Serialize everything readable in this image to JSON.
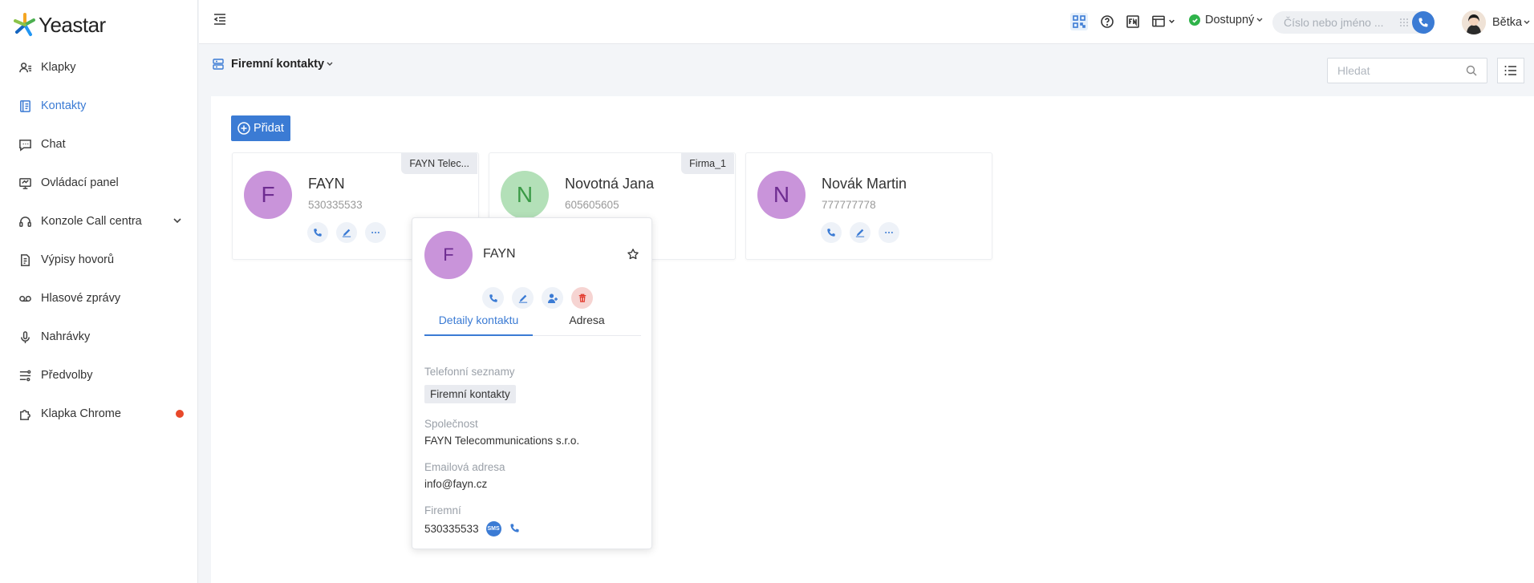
{
  "app": {
    "brand": "Yeastar"
  },
  "sidebar": {
    "items": [
      {
        "label": "Klapky",
        "icon": "user-list-icon"
      },
      {
        "label": "Kontakty",
        "icon": "contacts-book-icon",
        "active": true
      },
      {
        "label": "Chat",
        "icon": "chat-bubble-icon"
      },
      {
        "label": "Ovládací panel",
        "icon": "dashboard-icon"
      },
      {
        "label": "Konzole Call centra",
        "icon": "headset-icon",
        "expandable": true
      },
      {
        "label": "Výpisy hovorů",
        "icon": "call-log-icon"
      },
      {
        "label": "Hlasové zprávy",
        "icon": "voicemail-icon"
      },
      {
        "label": "Nahrávky",
        "icon": "microphone-icon"
      },
      {
        "label": "Předvolby",
        "icon": "preferences-icon"
      },
      {
        "label": "Klapka Chrome",
        "icon": "puzzle-icon",
        "notification_dot": true
      }
    ]
  },
  "topbar": {
    "status_label": "Dostupný",
    "dial_placeholder": "Číslo nebo jméno ...",
    "user_name": "Bětka"
  },
  "subheader": {
    "phonebook_label": "Firemní kontakty",
    "search_placeholder": "Hledat"
  },
  "main": {
    "add_label": "Přidat",
    "cards": [
      {
        "initial": "F",
        "name": "FAYN",
        "number": "530335533",
        "tag": "FAYN Telec...",
        "avatar_bg": "#c994da",
        "avatar_fg": "#6e2c91"
      },
      {
        "initial": "N",
        "name": "Novotná Jana",
        "number": "605605605",
        "tag": "Firma_1",
        "avatar_bg": "#b3e0b8",
        "avatar_fg": "#3a9a46"
      },
      {
        "initial": "N",
        "name": "Novák Martin",
        "number": "777777778",
        "tag": "",
        "avatar_bg": "#c994da",
        "avatar_fg": "#6e2c91"
      }
    ]
  },
  "popup": {
    "initial": "F",
    "name": "FAYN",
    "tabs": [
      "Detaily kontaktu",
      "Adresa"
    ],
    "phonebooks_label": "Telefonní seznamy",
    "phonebook_chip": "Firemní kontakty",
    "company_label": "Společnost",
    "company_value": "FAYN Telecommunications s.r.o.",
    "email_label": "Emailová adresa",
    "email_value": "info@fayn.cz",
    "business_label": "Firemní",
    "business_value": "530335533",
    "sms_label": "SMS"
  },
  "colors": {
    "accent": "#3b7bd4",
    "available": "#2fb34a",
    "danger": "#e23b2e"
  }
}
